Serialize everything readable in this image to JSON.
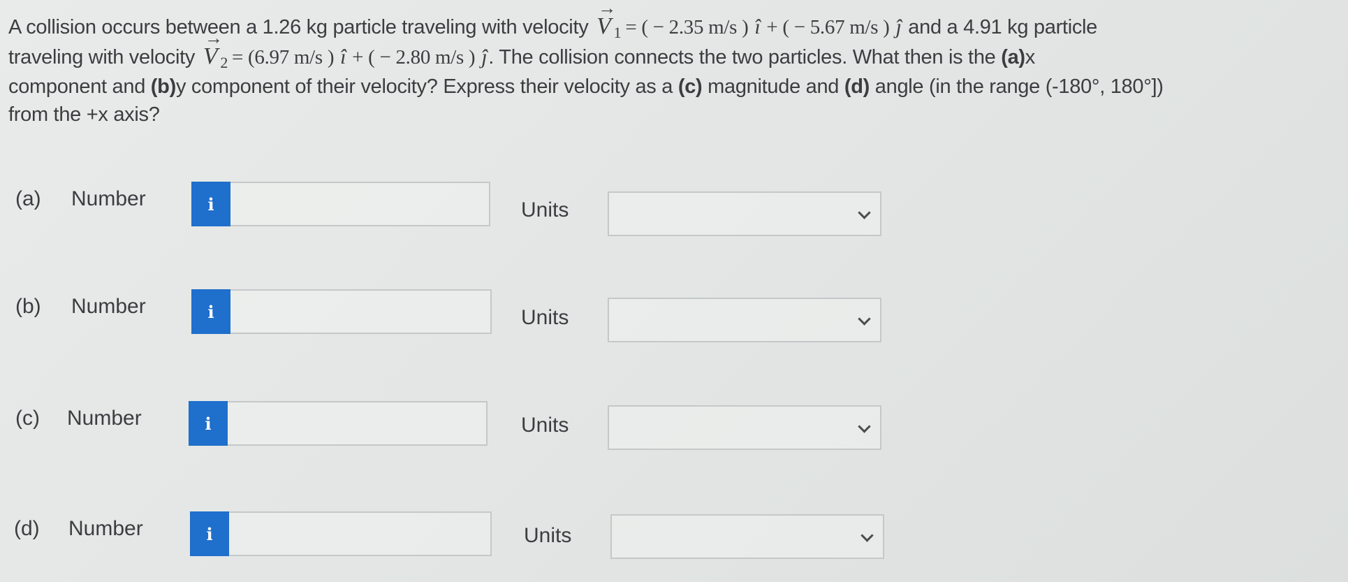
{
  "problem": {
    "line1_pre": "A collision occurs between a 1.26 kg particle traveling with velocity",
    "v1_symbol": "V",
    "v1_sub": "1",
    "v1_eq": "= ( − 2.35  m/s ) ",
    "i_hat": "î",
    "plus": " + ( − 5.67  m/s ) ",
    "j_hat": "ĵ",
    "line1_post": " and a 4.91 kg particle",
    "line2_pre": "traveling with velocity",
    "v2_symbol": "V",
    "v2_sub": "2",
    "v2_eq": "= (6.97  m/s ) ",
    "v2_plus": " + ( − 2.80  m/s ) ",
    "line2_post": ". The collision connects the two particles. What then is the ",
    "line2_a": "(a)",
    "line2_end": "x",
    "line3_pre": "component and ",
    "line3_b": "(b)",
    "line3_mid": "y component of their velocity? Express their velocity as a ",
    "line3_c": "(c)",
    "line3_mid2": " magnitude and ",
    "line3_d": "(d)",
    "line3_end": " angle (in the range (-180°, 180°])",
    "line4": "from the +x axis?"
  },
  "parts": [
    {
      "label": "(a)",
      "number_label": "Number",
      "info_icon": "i",
      "number_value": "",
      "units_label": "Units",
      "units_value": ""
    },
    {
      "label": "(b)",
      "number_label": "Number",
      "info_icon": "i",
      "number_value": "",
      "units_label": "Units",
      "units_value": ""
    },
    {
      "label": "(c)",
      "number_label": "Number",
      "info_icon": "i",
      "number_value": "",
      "units_label": "Units",
      "units_value": ""
    },
    {
      "label": "(d)",
      "number_label": "Number",
      "info_icon": "i",
      "number_value": "",
      "units_label": "Units",
      "units_value": ""
    }
  ],
  "colors": {
    "info_button": "#1f6fcc",
    "text": "#3b3d40",
    "border": "#c5c8c8"
  }
}
